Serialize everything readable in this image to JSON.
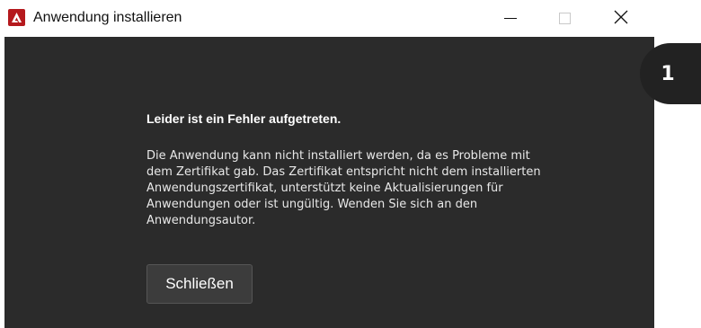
{
  "window": {
    "title": "Anwendung installieren",
    "app_icon": "adobe-air-icon",
    "controls": {
      "minimize_icon": "minimize-icon",
      "maximize_icon": "maximize-icon",
      "close_icon": "close-icon"
    }
  },
  "dialog": {
    "heading": "Leider ist ein Fehler aufgetreten.",
    "message": "Die Anwendung kann nicht installiert werden, da es Probleme mit\ndem Zertifikat gab. Das Zertifikat entspricht nicht dem installierten\nAnwendungszertifikat, unterstützt keine Aktualisierungen für\nAnwendungen oder ist ungültig. Wenden Sie sich an den\nAnwendungsautor.",
    "close_button_label": "Schließen"
  },
  "step_badge": {
    "number": "1"
  },
  "colors": {
    "window_background": "#2b2b2b",
    "titlebar_background": "#ffffff",
    "app_icon_red": "#b5191d",
    "badge_background": "#222222"
  }
}
